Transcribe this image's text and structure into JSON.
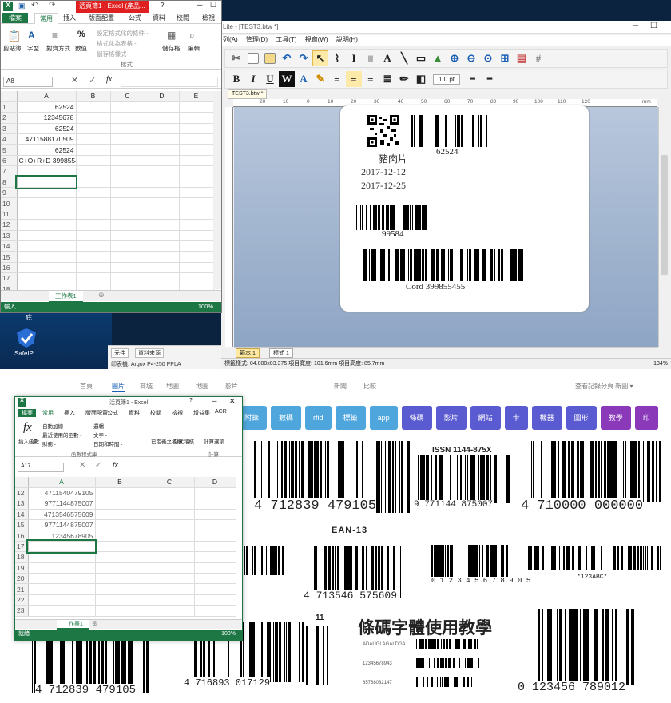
{
  "excel_top": {
    "title": "活頁簿1 - Excel (產品...",
    "question": "?",
    "tabs": [
      "檔案",
      "常用",
      "插入",
      "版面配置",
      "公式",
      "資料",
      "校閱",
      "檢視"
    ],
    "groups": {
      "paste": "剪貼簿",
      "font": "字型",
      "align": "對齊方式",
      "number": "數值",
      "cells": "儲存格",
      "edit": "編輯",
      "styles": "樣式"
    },
    "styles_items": [
      "設定格式化的條件 -",
      "格式化為表格 -",
      "儲存格樣式 -"
    ],
    "name_box": "A8",
    "fx": "fx",
    "columns": [
      "A",
      "B",
      "C",
      "D",
      "E"
    ],
    "rows": [
      {
        "n": "1",
        "a": "62524"
      },
      {
        "n": "2",
        "a": "12345678"
      },
      {
        "n": "3",
        "a": "62524"
      },
      {
        "n": "4",
        "a": "4711588170509"
      },
      {
        "n": "5",
        "a": "62524"
      },
      {
        "n": "6",
        "a": "C+O+R+D 399855455"
      },
      {
        "n": "7",
        "a": ""
      },
      {
        "n": "8",
        "a": ""
      },
      {
        "n": "9",
        "a": ""
      },
      {
        "n": "10",
        "a": ""
      },
      {
        "n": "11",
        "a": ""
      },
      {
        "n": "12",
        "a": ""
      },
      {
        "n": "13",
        "a": ""
      },
      {
        "n": "14",
        "a": ""
      },
      {
        "n": "15",
        "a": ""
      },
      {
        "n": "16",
        "a": ""
      },
      {
        "n": "17",
        "a": ""
      },
      {
        "n": "18",
        "a": ""
      }
    ],
    "sheet_tab": "工作表1",
    "status": "輸入",
    "zoom": "100%"
  },
  "desktop": {
    "icon_label": "SafeIP",
    "top_label": "底",
    "taskbar": [
      "元件",
      "資料來源"
    ],
    "printer": "印表機: Argox P4-250 PPLA"
  },
  "bartender": {
    "title": "Lite - [TEST3.btw *]",
    "menu": [
      "列(A)",
      "管理(D)",
      "工具(T)",
      "視窗(W)",
      "說明(H)"
    ],
    "doc_tab": "TEST3.btw *",
    "font_size": "1.0 pt",
    "ruler_labels": [
      "20",
      "10",
      "0",
      "10",
      "20",
      "30",
      "40",
      "50",
      "60",
      "70",
      "80",
      "90",
      "100",
      "110",
      "120",
      "mm"
    ],
    "label": {
      "code1": "62524",
      "name": "豬肉片",
      "date1": "2017-12-12",
      "date2": "2017-12-25",
      "code2": "99584",
      "code3": "Cord 399855455"
    },
    "sheet_tabs": [
      "範本 1",
      "標式 1"
    ],
    "status": "標籤樣式: 04.000x03.375  項目寬度: 101.6mm  項目高度: 85.7mm",
    "zoom": "134%"
  },
  "web": {
    "nav": [
      "首頁",
      "圖片",
      "商城",
      "地圖",
      "地圖",
      "影片",
      "新聞",
      "比較"
    ],
    "top_right": "查看記錄分頁 新圖 ▾",
    "pills": [
      {
        "label": "附錄",
        "color": "#4ea6dc"
      },
      {
        "label": "數碼",
        "color": "#4ea6dc"
      },
      {
        "label": "rfid",
        "color": "#4ea6dc"
      },
      {
        "label": "標籤",
        "color": "#4ea6dc"
      },
      {
        "label": "app",
        "color": "#4ea6dc"
      },
      {
        "label": "條碼",
        "color": "#5b5bd1"
      },
      {
        "label": "影片",
        "color": "#5b5bd1"
      },
      {
        "label": "網站",
        "color": "#5b5bd1"
      },
      {
        "label": "卡",
        "color": "#5b5bd1"
      },
      {
        "label": "機器",
        "color": "#5b5bd1"
      },
      {
        "label": "圖形",
        "color": "#5b5bd1"
      },
      {
        "label": "教學",
        "color": "#8a3ab9"
      },
      {
        "label": "印",
        "color": "#8a3ab9"
      }
    ],
    "codes": {
      "b1": "4 712839 479105",
      "issn_head": "ISSN 1144-875X",
      "issn": "9 771144 875007",
      "b3": "4 710000 000000",
      "ean_title": "EAN-13",
      "b4": "4 713546 575609",
      "b5": "0 1 2 3 4 5 6 7 8 9 0 5",
      "b6": "*123ABC*",
      "b7": "4 712839 479105",
      "b8": "4 716893 017129",
      "eleven": "11",
      "teach_title": "條碼字體使用教學",
      "teach1": "ADAUGLAGALDGA",
      "teach2": "12345678943",
      "teach3": "85768032147",
      "b9": "0 123456 789012"
    }
  },
  "excel_bot": {
    "title": "活頁簿1 - Excel",
    "question": "?",
    "tabs": [
      "檔案",
      "常用",
      "插入",
      "版面配置",
      "公式",
      "資料",
      "校閱",
      "檢視",
      "增益集",
      "ACR"
    ],
    "fx_label": "fx",
    "insert_fn": "插入函數",
    "lib_items": [
      "自動加總 -",
      "最近使用的函數 -",
      "財務 -"
    ],
    "lib_items2": [
      "邏輯 -",
      "文字 -",
      "日期和時間 -"
    ],
    "lib": "函數程式庫",
    "defined": "已定義之名稱",
    "audit": "公式稽核",
    "calc": "計算",
    "calc_opt": "計算選項",
    "name_box": "A17",
    "columns": [
      "A",
      "B",
      "C",
      "D"
    ],
    "rows": [
      {
        "n": "12",
        "a": "4711540479105"
      },
      {
        "n": "13",
        "a": "9771144875007"
      },
      {
        "n": "14",
        "a": "4713546575609"
      },
      {
        "n": "15",
        "a": "9771144875007"
      },
      {
        "n": "16",
        "a": "12345678905"
      },
      {
        "n": "17",
        "a": ""
      },
      {
        "n": "18",
        "a": ""
      },
      {
        "n": "19",
        "a": ""
      },
      {
        "n": "20",
        "a": ""
      },
      {
        "n": "21",
        "a": ""
      },
      {
        "n": "22",
        "a": ""
      },
      {
        "n": "23",
        "a": ""
      }
    ],
    "sheet_tab": "工作表1",
    "status": "就緒",
    "zoom": "100%"
  }
}
